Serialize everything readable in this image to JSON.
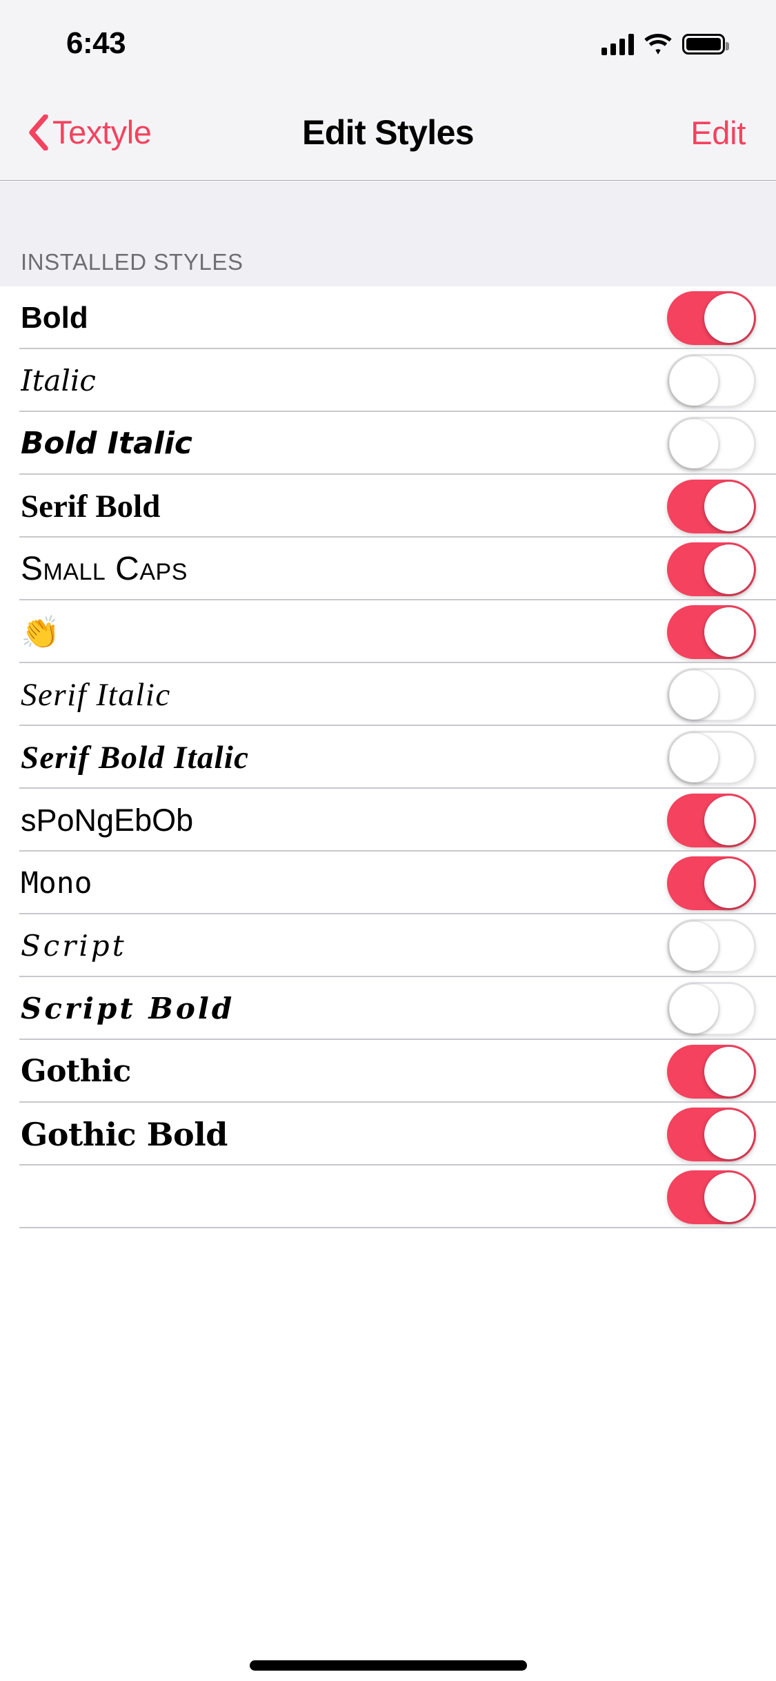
{
  "status_bar": {
    "time": "6:43",
    "cellular_icon": "signal-bars-icon",
    "wifi_icon": "wifi-icon",
    "battery_icon": "battery-full-icon"
  },
  "nav_bar": {
    "back_icon": "chevron-left-icon",
    "back_label": "Textyle",
    "title": "Edit Styles",
    "edit_label": "Edit"
  },
  "section": {
    "header": "INSTALLED STYLES"
  },
  "colors": {
    "accent": "#f4425f",
    "nav_background": "#f4f4f6",
    "section_background": "#efeff4",
    "row_background": "#ffffff",
    "separator": "#c8c7cc",
    "section_label": "#6d6d72",
    "toggle_off_track": "#e3e3e5"
  },
  "styles": [
    {
      "label": "Bold",
      "enabled": true,
      "class": "st-bold"
    },
    {
      "label": "Italic",
      "enabled": false,
      "class": "st-italic"
    },
    {
      "label": "Bold Italic",
      "enabled": false,
      "class": "st-bolditalic"
    },
    {
      "label": "Serif Bold",
      "enabled": true,
      "class": "st-serifbold"
    },
    {
      "label": "Small Caps",
      "enabled": true,
      "class": "st-smallcaps"
    },
    {
      "label": "👏",
      "enabled": true,
      "class": "st-emoji"
    },
    {
      "label": "Serif Italic",
      "enabled": false,
      "class": "st-serifitalic"
    },
    {
      "label": "Serif Bold Italic",
      "enabled": false,
      "class": "st-serifbolditalic"
    },
    {
      "label": "sPoNgEbOb",
      "enabled": true,
      "class": "st-spongebob"
    },
    {
      "label": "Mono",
      "enabled": true,
      "class": "st-mono"
    },
    {
      "label": "Script",
      "enabled": false,
      "class": "st-script"
    },
    {
      "label": "Script Bold",
      "enabled": false,
      "class": "st-scriptbold"
    },
    {
      "label": "Gothic",
      "enabled": true,
      "class": "st-gothic"
    },
    {
      "label": "Gothic Bold",
      "enabled": true,
      "class": "st-gothicbold"
    },
    {
      "label": "",
      "enabled": true,
      "class": "st-bold"
    }
  ]
}
